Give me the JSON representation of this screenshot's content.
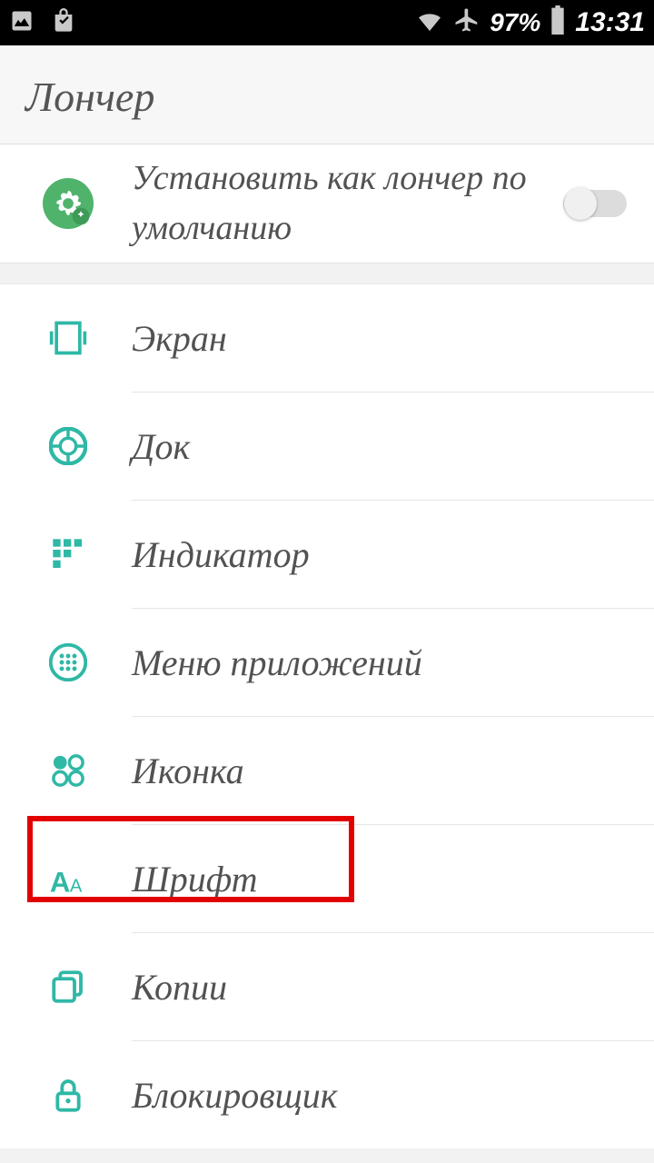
{
  "status": {
    "battery_pct": "97%",
    "time": "13:31"
  },
  "header": {
    "title": "Лончер"
  },
  "default_launcher": {
    "label": "Установить как лончер по умолчанию",
    "toggled": false
  },
  "items": [
    {
      "icon": "screen-icon",
      "label": "Экран"
    },
    {
      "icon": "dock-icon",
      "label": "Док"
    },
    {
      "icon": "indicator-icon",
      "label": "Индикатор"
    },
    {
      "icon": "app-menu-icon",
      "label": "Меню приложений"
    },
    {
      "icon": "icon-icon",
      "label": "Иконка"
    },
    {
      "icon": "font-icon",
      "label": "Шрифт",
      "highlighted": true
    },
    {
      "icon": "copies-icon",
      "label": "Копии"
    },
    {
      "icon": "lock-icon",
      "label": "Блокировщик"
    }
  ]
}
